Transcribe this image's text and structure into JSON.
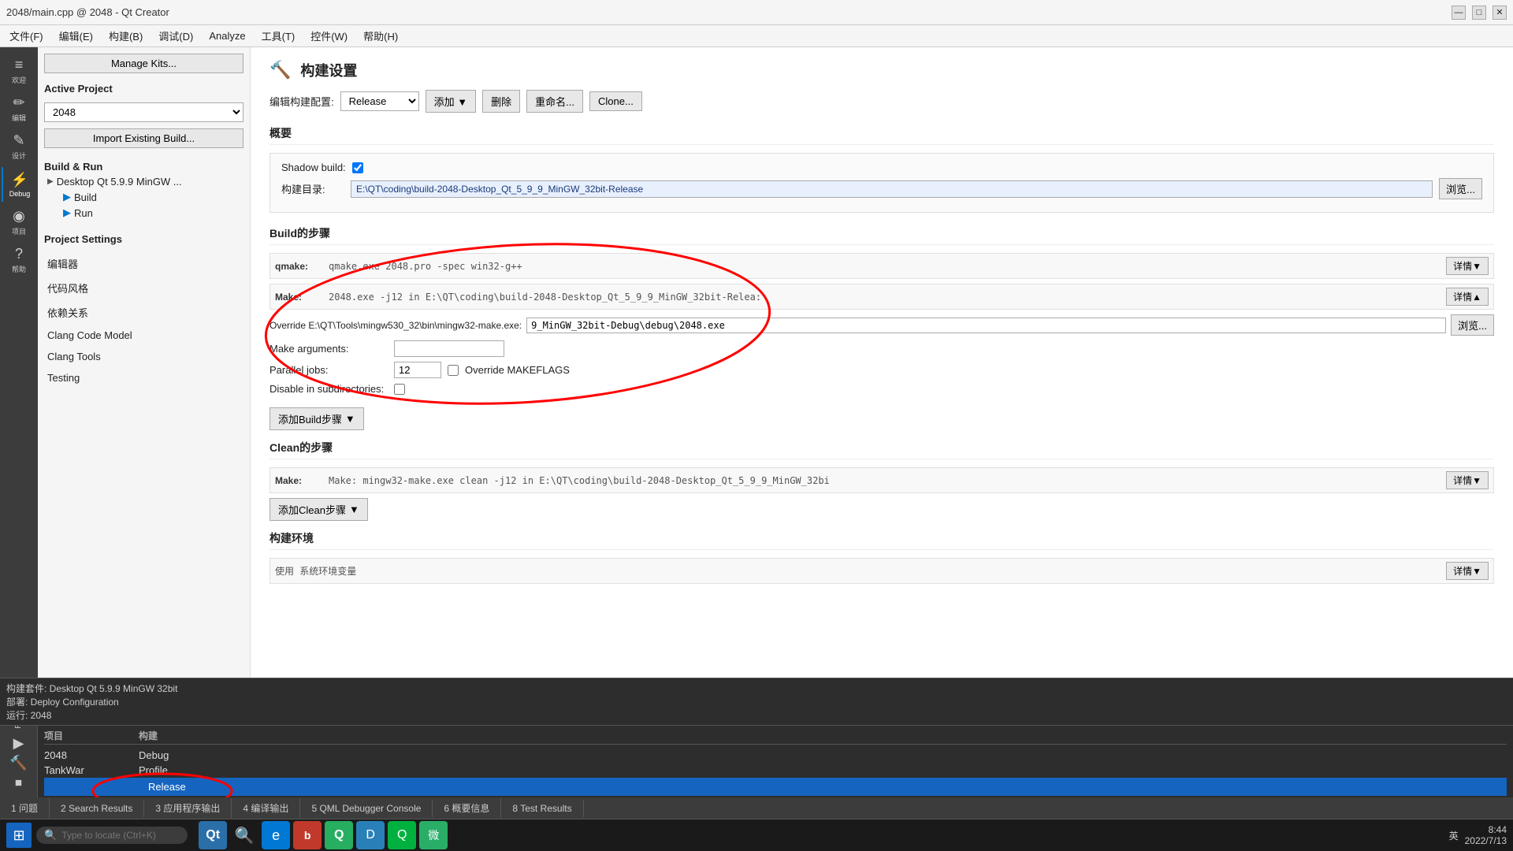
{
  "window": {
    "title": "2048/main.cpp @ 2048 - Qt Creator"
  },
  "menubar": {
    "items": [
      "文件(F)",
      "编辑(E)",
      "构建(B)",
      "调试(D)",
      "Analyze",
      "工具(T)",
      "控件(W)",
      "帮助(H)"
    ]
  },
  "titlebar": {
    "min": "—",
    "max": "□",
    "close": "✕"
  },
  "left_panel": {
    "manage_kits_btn": "Manage Kits...",
    "active_project_label": "Active Project",
    "project_name": "2048",
    "import_btn": "Import Existing Build...",
    "build_run_label": "Build & Run",
    "tree_item": "Desktop Qt 5.9.9 MinGW ...",
    "build_sub": "Build",
    "run_sub": "Run",
    "project_settings_label": "Project Settings",
    "settings_links": [
      "编辑器",
      "代码风格",
      "依赖关系",
      "Clang Code Model",
      "Clang Tools",
      "Testing"
    ]
  },
  "right_content": {
    "page_title": "构建设置",
    "config_label": "编辑构建配置:",
    "config_value": "Release",
    "add_btn": "添加",
    "delete_btn": "删除",
    "rename_btn": "重命名...",
    "clone_btn": "Clone...",
    "overview_label": "概要",
    "shadow_build_label": "Shadow build:",
    "build_dir_label": "构建目录:",
    "build_dir_value": "E:\\QT\\coding\\build-2048-Desktop_Qt_5_9_9_MinGW_32bit-Release",
    "browse_btn": "浏览...",
    "build_steps_label": "Build的步骤",
    "qmake_key": "qmake:",
    "qmake_val": "qmake.exe 2048.pro -spec win32-g++",
    "make_key": "Make:",
    "make_val": "2048.exe -j12 in E:\\QT\\coding\\build-2048-Desktop_Qt_5_9_9_MinGW_32bit-Relea:",
    "override_label": "Override E:\\QT\\Tools\\mingw530_32\\bin\\mingw32-make.exe:",
    "override_val": "9_MinGW_32bit-Debug\\debug\\2048.exe",
    "make_args_label": "Make arguments:",
    "parallel_jobs_label": "Parallel jobs:",
    "parallel_val": "12",
    "override_makeflags_label": "Override MAKEFLAGS",
    "disable_subdirs_label": "Disable in subdirectories:",
    "add_build_step_btn": "添加Build步骤",
    "clean_steps_label": "Clean的步骤",
    "clean_make_val": "Make: mingw32-make.exe clean -j12 in E:\\QT\\coding\\build-2048-Desktop_Qt_5_9_9_MinGW_32bi",
    "add_clean_step_btn": "添加Clean步骤",
    "build_env_label": "构建环境",
    "env_val": "使用 系统环境变量",
    "detail_btn": "详情",
    "detail_btn2": "详情"
  },
  "bottom_area": {
    "status_line1": "构建套件: Desktop Qt 5.9.9 MinGW 32bit",
    "status_line2": "部署: Deploy Configuration",
    "status_line3": "运行: 2048",
    "col_project": "项目",
    "col_build": "构建",
    "rows": [
      {
        "project": "2048",
        "build": "Debug"
      },
      {
        "project": "TankWar",
        "build": "Profile"
      },
      {
        "project": "",
        "build": "Release",
        "highlighted": true
      }
    ],
    "release_side_label": "Release",
    "release_badge": "Release"
  },
  "bottom_tabs": {
    "tabs": [
      "1 问题",
      "2 Search Results",
      "3 应用程序输出",
      "4 编译输出",
      "5 QML Debugger Console",
      "6 概要信息",
      "8 Test Results"
    ]
  },
  "taskbar": {
    "search_placeholder": "Type to locate (Ctrl+K)",
    "time": "8:44",
    "date": "2022/7/13",
    "apps": [
      "Qt",
      "Edge",
      "博客园",
      "Qt App",
      "Dev",
      "QQ",
      "WeChat"
    ],
    "lang": "英",
    "layout": "英"
  },
  "sidebar_icons": [
    {
      "icon": "≡",
      "label": "欢迎"
    },
    {
      "icon": "✏",
      "label": "编辑"
    },
    {
      "icon": "✎",
      "label": "设计"
    },
    {
      "icon": "⚡",
      "label": "Debug"
    },
    {
      "icon": "◉",
      "label": "项目"
    },
    {
      "icon": "?",
      "label": "帮助"
    }
  ]
}
